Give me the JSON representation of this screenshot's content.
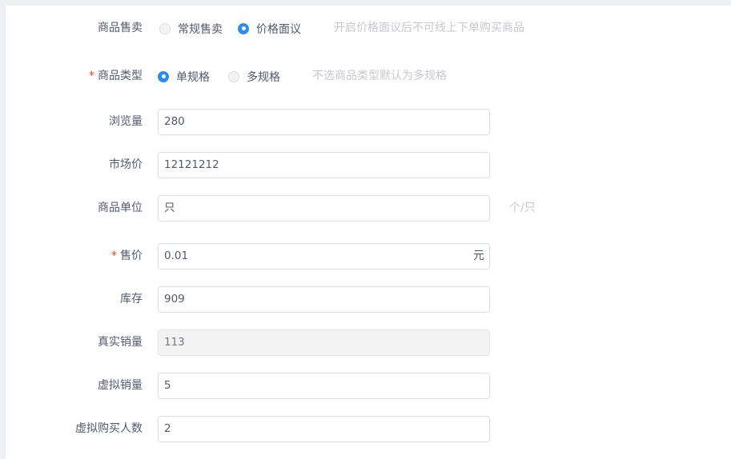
{
  "form": {
    "sale_mode": {
      "label": "商品售卖",
      "options": [
        "常规售卖",
        "价格面议"
      ],
      "selected": "价格面议",
      "hint": "开启价格面议后不可线上下单购买商品"
    },
    "product_type": {
      "required_mark": "*",
      "label": "商品类型",
      "options": [
        "单规格",
        "多规格"
      ],
      "selected": "单规格",
      "hint": "不选商品类型默认为多规格"
    },
    "views": {
      "label": "浏览量",
      "value": "280"
    },
    "market_price": {
      "label": "市场价",
      "value": "12121212"
    },
    "unit": {
      "label": "商品单位",
      "value": "只",
      "hint": "个/只"
    },
    "price": {
      "required_mark": "*",
      "label": "售价",
      "value": "0.01",
      "suffix": "元"
    },
    "stock": {
      "label": "库存",
      "value": "909"
    },
    "real_sales": {
      "label": "真实销量",
      "value": "113",
      "disabled": true
    },
    "virtual_sales": {
      "label": "虚拟销量",
      "value": "5"
    },
    "virtual_buyers": {
      "label": "虚拟购买人数",
      "value": "2"
    }
  }
}
